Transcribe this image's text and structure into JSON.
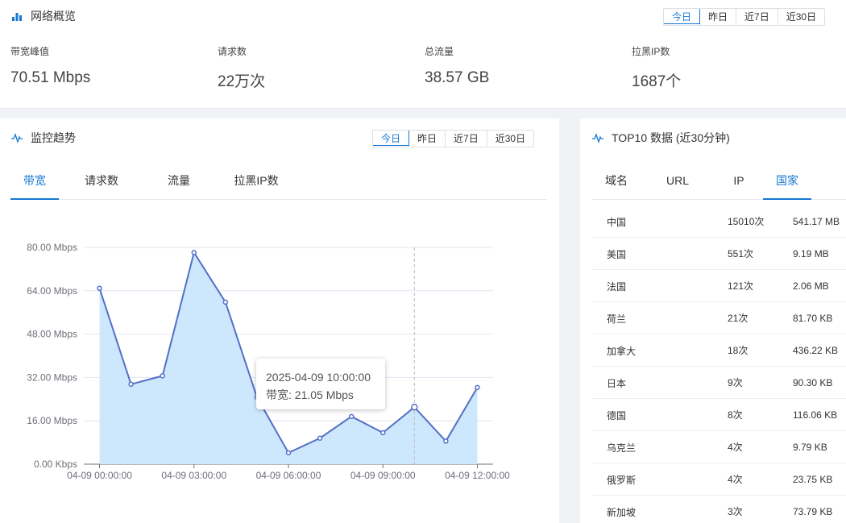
{
  "overview": {
    "title": "网络概览",
    "ranges": [
      "今日",
      "昨日",
      "近7日",
      "近30日"
    ],
    "active_range": 0,
    "stats": [
      {
        "label": "带宽峰值",
        "value": "70.51 Mbps"
      },
      {
        "label": "请求数",
        "value": "22万次"
      },
      {
        "label": "总流量",
        "value": "38.57 GB"
      },
      {
        "label": "拉黑IP数",
        "value": "1687个"
      }
    ]
  },
  "monitor": {
    "title": "监控趋势",
    "ranges": [
      "今日",
      "昨日",
      "近7日",
      "近30日"
    ],
    "active_range": 0,
    "tabs": [
      "带宽",
      "请求数",
      "流量",
      "拉黑IP数"
    ],
    "active_tab": 0,
    "tooltip": {
      "time": "2025-04-09 10:00:00",
      "text": "带宽: 21.05 Mbps"
    }
  },
  "chart_data": {
    "type": "area",
    "x": [
      "04-09 00:00:00",
      "04-09 01:00:00",
      "04-09 02:00:00",
      "04-09 03:00:00",
      "04-09 04:00:00",
      "04-09 05:00:00",
      "04-09 06:00:00",
      "04-09 07:00:00",
      "04-09 08:00:00",
      "04-09 09:00:00",
      "04-09 10:00:00",
      "04-09 11:00:00",
      "04-09 12:00:00"
    ],
    "values": [
      64.9,
      29.5,
      32.6,
      78.1,
      59.8,
      24.7,
      4.2,
      9.6,
      17.6,
      11.6,
      21.05,
      8.5,
      28.3
    ],
    "x_tick_labels": [
      "04-09 00:00:00",
      "04-09 03:00:00",
      "04-09 06:00:00",
      "04-09 09:00:00",
      "04-09 12:00:00"
    ],
    "x_tick_index": [
      0,
      3,
      6,
      9,
      12
    ],
    "y_ticks": [
      0,
      16,
      32,
      48,
      64,
      80
    ],
    "y_tick_labels": [
      "0.00 Kbps",
      "16.00 Mbps",
      "32.00 Mbps",
      "48.00 Mbps",
      "64.00 Mbps",
      "80.00 Mbps"
    ],
    "ylim": [
      0,
      80
    ],
    "grid": true,
    "hover_index": 10,
    "line_color": "#5470c6",
    "area_color": "#cde7fc"
  },
  "top10": {
    "title": "TOP10 数据 (近30分钟)",
    "tabs": [
      "域名",
      "URL",
      "IP",
      "国家"
    ],
    "active_tab": 3,
    "rows": [
      {
        "name": "中国",
        "count": "15010次",
        "size": "541.17 MB"
      },
      {
        "name": "美国",
        "count": "551次",
        "size": "9.19 MB"
      },
      {
        "name": "法国",
        "count": "121次",
        "size": "2.06 MB"
      },
      {
        "name": "荷兰",
        "count": "21次",
        "size": "81.70 KB"
      },
      {
        "name": "加拿大",
        "count": "18次",
        "size": "436.22 KB"
      },
      {
        "name": "日本",
        "count": "9次",
        "size": "90.30 KB"
      },
      {
        "name": "德国",
        "count": "8次",
        "size": "116.06 KB"
      },
      {
        "name": "乌克兰",
        "count": "4次",
        "size": "9.79 KB"
      },
      {
        "name": "俄罗斯",
        "count": "4次",
        "size": "23.75 KB"
      },
      {
        "name": "新加坡",
        "count": "3次",
        "size": "73.79 KB"
      }
    ]
  },
  "colors": {
    "accent": "#1677d2",
    "line": "#5470c6",
    "area": "#cde7fc"
  }
}
